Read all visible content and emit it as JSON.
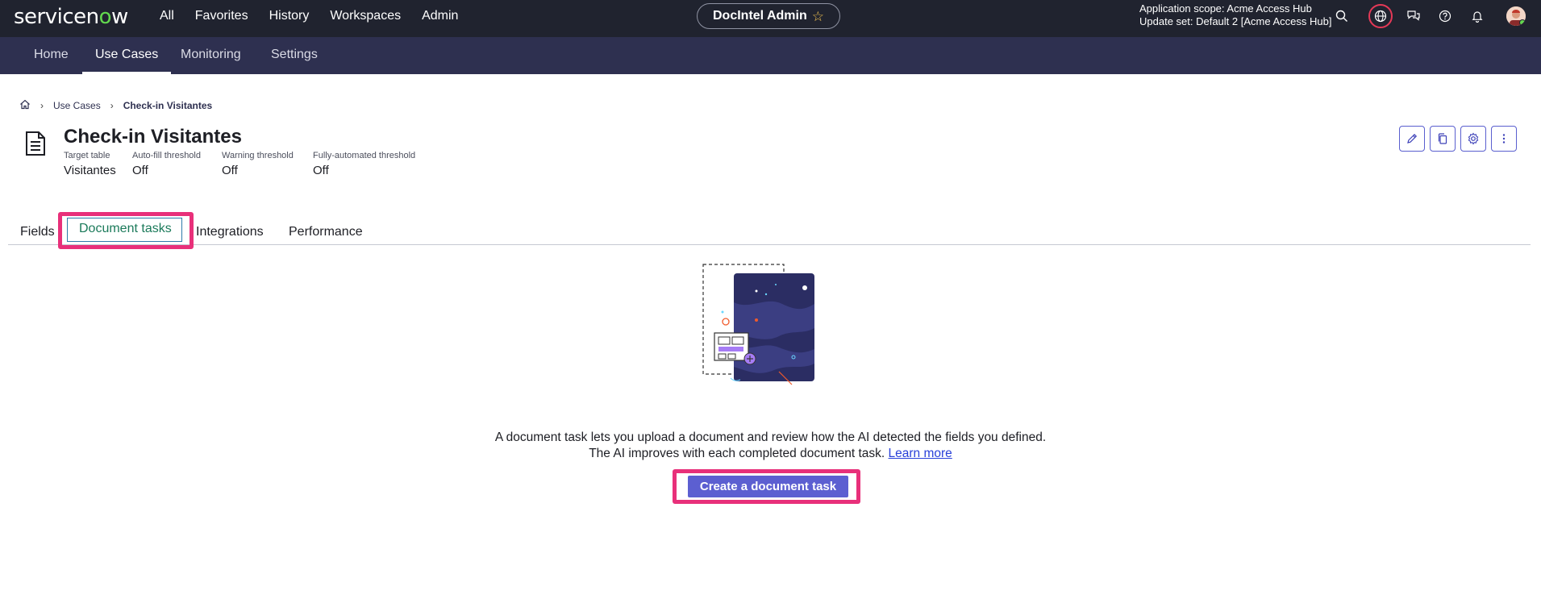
{
  "header": {
    "logo_text": "servicenow",
    "nav": [
      "All",
      "Favorites",
      "History",
      "Workspaces",
      "Admin"
    ],
    "workspace_title": "DocIntel Admin",
    "scope_line1": "Application scope: Acme Access Hub",
    "scope_line2": "Update set: Default 2 [Acme Access Hub]",
    "icons": [
      "search-icon",
      "globe-icon",
      "chat-icon",
      "help-icon",
      "bell-icon",
      "avatar"
    ]
  },
  "subnav": {
    "items": [
      "Home",
      "Use Cases",
      "Monitoring",
      "Settings"
    ],
    "active": "Use Cases"
  },
  "breadcrumb": {
    "items": [
      "Use Cases",
      "Check-in Visitantes"
    ]
  },
  "record": {
    "title": "Check-in Visitantes",
    "meta": [
      {
        "label": "Target table",
        "value": "Visitantes"
      },
      {
        "label": "Auto-fill threshold",
        "value": "Off"
      },
      {
        "label": "Warning threshold",
        "value": "Off"
      },
      {
        "label": "Fully-automated threshold",
        "value": "Off"
      }
    ],
    "actions": [
      "edit-icon",
      "copy-icon",
      "gear-icon",
      "more-icon"
    ]
  },
  "tabs": {
    "items": [
      "Fields",
      "Document tasks",
      "Integrations",
      "Performance"
    ],
    "selected": "Document tasks"
  },
  "empty_state": {
    "line1": "A document task lets you upload a document and review how the AI detected the fields you defined.",
    "line2": "The AI improves with each completed document task.",
    "link": "Learn more",
    "button": "Create a document task"
  },
  "colors": {
    "header_bg": "#20232f",
    "subnav_bg": "#2e3050",
    "primary": "#5c5fd1",
    "highlight": "#e8307a",
    "selected_tab": "#1b7a5a"
  }
}
